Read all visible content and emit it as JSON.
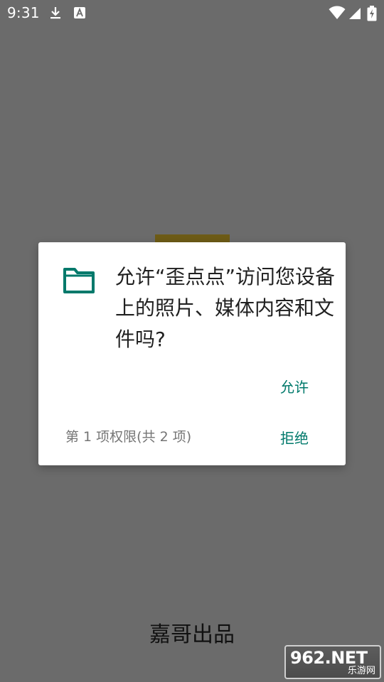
{
  "status_bar": {
    "time": "9:31",
    "icons": [
      "download-icon",
      "accessibility-a-icon",
      "wifi-icon",
      "cellular-signal-icon",
      "battery-charging-icon"
    ]
  },
  "app": {
    "bottom_label": "嘉哥出品"
  },
  "dialog": {
    "icon": "folder-icon",
    "message": "允许“歪点点”访问您设备上的照片、媒体内容和文件吗?",
    "allow_label": "允许",
    "deny_label": "拒绝",
    "counter": "第 1 项权限(共 2 项)"
  },
  "watermark": {
    "main": "962.NET",
    "sub": "乐游网"
  },
  "colors": {
    "accent": "#00796b",
    "scrim": "#6b6b6b"
  }
}
